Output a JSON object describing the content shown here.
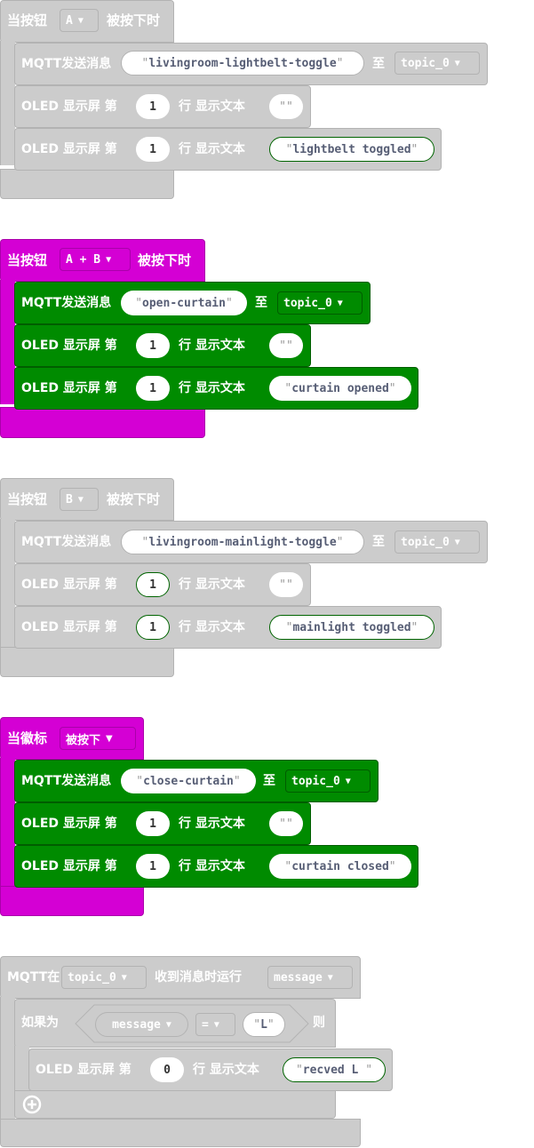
{
  "colors": {
    "gray": "#cccccc",
    "gray_dark": "#b3b3b3",
    "magenta": "#d400d4",
    "magenta_dark": "#aa00aa",
    "green": "#008b00",
    "green_dark": "#005d00",
    "text_gray": "#575e75",
    "pill_green_border": "#006400"
  },
  "event_a": {
    "prefix": "当按钮",
    "button": "A",
    "suffix": "被按下时",
    "mqtt": {
      "label": "MQTT发送消息",
      "message": "livingroom-lightbelt-toggle",
      "to": "至",
      "topic": "topic_0"
    },
    "oled1": {
      "prefix": "OLED 显示屏 第",
      "line": "1",
      "mid": "行 显示文本",
      "text": ""
    },
    "oled2": {
      "prefix": "OLED 显示屏 第",
      "line": "1",
      "mid": "行 显示文本",
      "text": "lightbelt toggled"
    }
  },
  "event_ab": {
    "prefix": "当按钮",
    "button": "A + B",
    "suffix": "被按下时",
    "mqtt": {
      "label": "MQTT发送消息",
      "message": "open-curtain",
      "to": "至",
      "topic": "topic_0"
    },
    "oled1": {
      "prefix": "OLED 显示屏 第",
      "line": "1",
      "mid": "行 显示文本",
      "text": ""
    },
    "oled2": {
      "prefix": "OLED 显示屏 第",
      "line": "1",
      "mid": "行 显示文本",
      "text": "curtain opened"
    }
  },
  "event_b": {
    "prefix": "当按钮",
    "button": "B",
    "suffix": "被按下时",
    "mqtt": {
      "label": "MQTT发送消息",
      "message": "livingroom-mainlight-toggle",
      "to": "至",
      "topic": "topic_0"
    },
    "oled1": {
      "prefix": "OLED 显示屏 第",
      "line": "1",
      "mid": "行 显示文本",
      "text": ""
    },
    "oled2": {
      "prefix": "OLED 显示屏 第",
      "line": "1",
      "mid": "行 显示文本",
      "text": "mainlight toggled"
    }
  },
  "event_logo": {
    "prefix": "当徽标",
    "action": "被按下",
    "mqtt": {
      "label": "MQTT发送消息",
      "message": "close-curtain",
      "to": "至",
      "topic": "topic_0"
    },
    "oled1": {
      "prefix": "OLED 显示屏 第",
      "line": "1",
      "mid": "行 显示文本",
      "text": ""
    },
    "oled2": {
      "prefix": "OLED 显示屏 第",
      "line": "1",
      "mid": "行 显示文本",
      "text": "curtain closed"
    }
  },
  "event_mqtt": {
    "prefix": "MQTT在",
    "topic": "topic_0",
    "suffix": "收到消息时运行",
    "var": "message",
    "if_label": "如果为",
    "cond_var": "message",
    "op": "=",
    "cond_value": "L",
    "then": "则",
    "oled": {
      "prefix": "OLED 显示屏 第",
      "line": "0",
      "mid": "行 显示文本",
      "text": "recved L "
    }
  }
}
